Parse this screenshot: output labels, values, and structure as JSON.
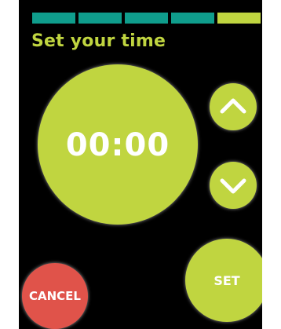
{
  "colors": {
    "background": "#000000",
    "accent": "#c0d540",
    "progress_done": "#0f9d8c",
    "progress_current": "#c0d540",
    "cancel": "#e0534a",
    "text_light": "#ffffff"
  },
  "progress": {
    "total_steps": 5,
    "current_step": 5
  },
  "header": {
    "title": "Set your time"
  },
  "timer": {
    "display": "00:00"
  },
  "controls": {
    "increase_icon": "chevron-up-icon",
    "decrease_icon": "chevron-down-icon",
    "set_label": "SET",
    "cancel_label": "CANCEL"
  }
}
